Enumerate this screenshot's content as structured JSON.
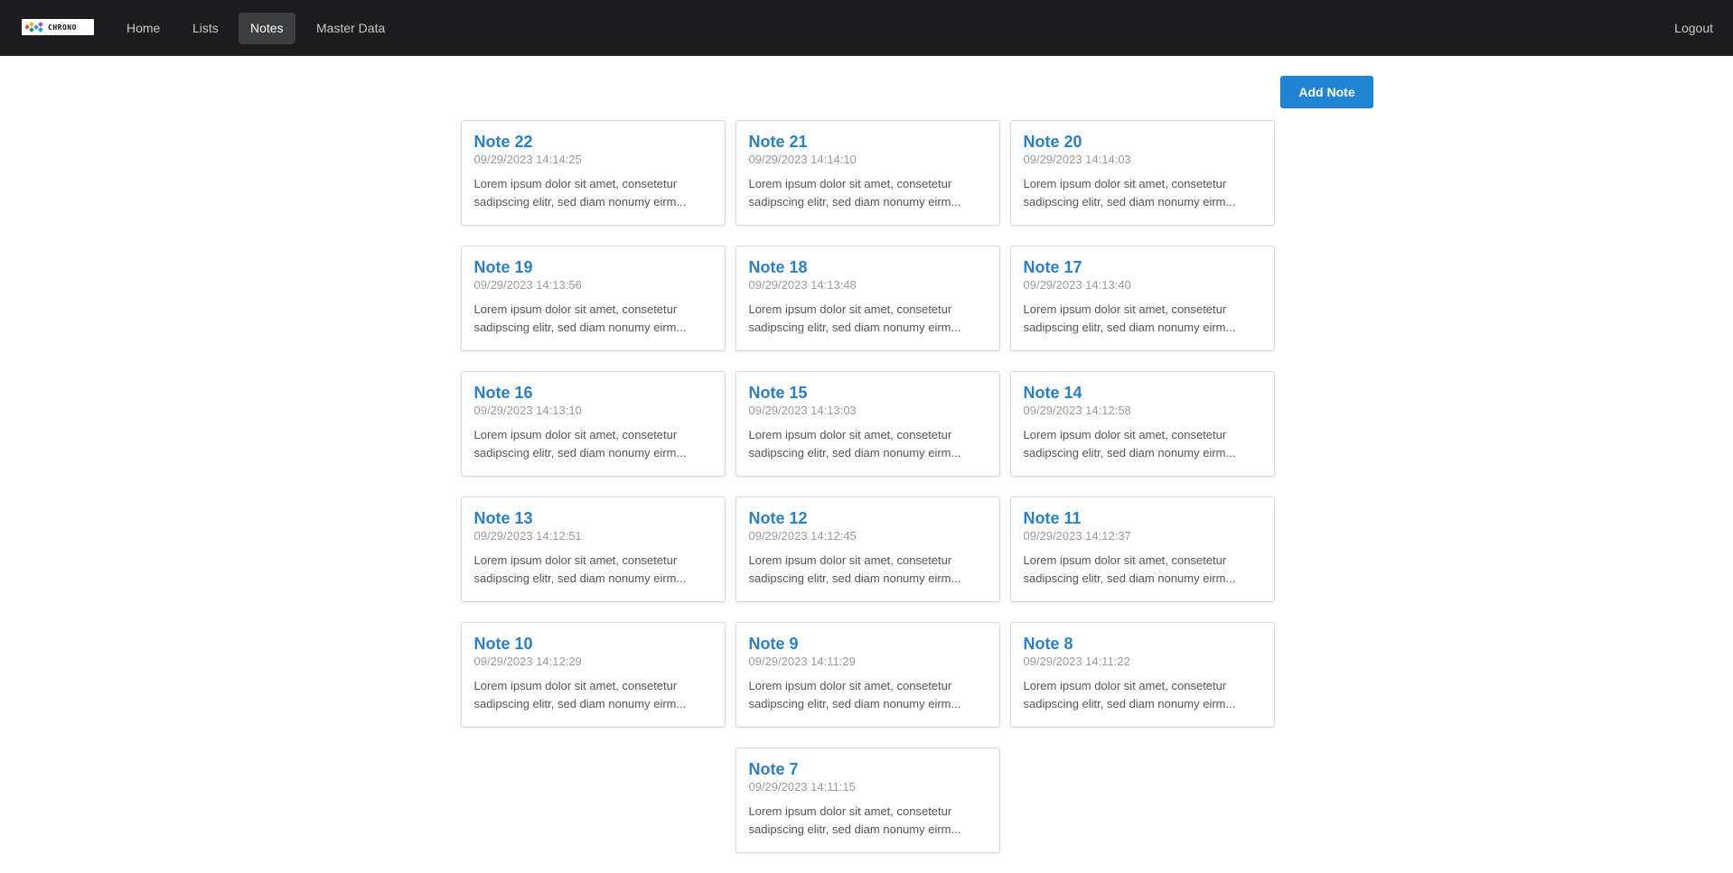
{
  "navbar": {
    "logo_text": "CHRONO",
    "items": [
      {
        "label": "Home",
        "active": false
      },
      {
        "label": "Lists",
        "active": false
      },
      {
        "label": "Notes",
        "active": true
      },
      {
        "label": "Master Data",
        "active": false
      }
    ],
    "logout_label": "Logout",
    "bg_color": "#1c1c1e"
  },
  "toolbar": {
    "add_label": "Add Note",
    "accent_color": "#2285d4"
  },
  "notes": [
    {
      "title": "Note 22",
      "date": "09/29/2023 14:14:25",
      "excerpt": "Lorem ipsum dolor sit amet, consetetur sadipscing elitr, sed diam nonumy eirm..."
    },
    {
      "title": "Note 21",
      "date": "09/29/2023 14:14:10",
      "excerpt": "Lorem ipsum dolor sit amet, consetetur sadipscing elitr, sed diam nonumy eirm..."
    },
    {
      "title": "Note 20",
      "date": "09/29/2023 14:14:03",
      "excerpt": "Lorem ipsum dolor sit amet, consetetur sadipscing elitr, sed diam nonumy eirm..."
    },
    {
      "title": "Note 19",
      "date": "09/29/2023 14:13:56",
      "excerpt": "Lorem ipsum dolor sit amet, consetetur sadipscing elitr, sed diam nonumy eirm..."
    },
    {
      "title": "Note 18",
      "date": "09/29/2023 14:13:48",
      "excerpt": "Lorem ipsum dolor sit amet, consetetur sadipscing elitr, sed diam nonumy eirm..."
    },
    {
      "title": "Note 17",
      "date": "09/29/2023 14:13:40",
      "excerpt": "Lorem ipsum dolor sit amet, consetetur sadipscing elitr, sed diam nonumy eirm..."
    },
    {
      "title": "Note 16",
      "date": "09/29/2023 14:13:10",
      "excerpt": "Lorem ipsum dolor sit amet, consetetur sadipscing elitr, sed diam nonumy eirm..."
    },
    {
      "title": "Note 15",
      "date": "09/29/2023 14:13:03",
      "excerpt": "Lorem ipsum dolor sit amet, consetetur sadipscing elitr, sed diam nonumy eirm..."
    },
    {
      "title": "Note 14",
      "date": "09/29/2023 14:12:58",
      "excerpt": "Lorem ipsum dolor sit amet, consetetur sadipscing elitr, sed diam nonumy eirm..."
    },
    {
      "title": "Note 13",
      "date": "09/29/2023 14:12:51",
      "excerpt": "Lorem ipsum dolor sit amet, consetetur sadipscing elitr, sed diam nonumy eirm..."
    },
    {
      "title": "Note 12",
      "date": "09/29/2023 14:12:45",
      "excerpt": "Lorem ipsum dolor sit amet, consetetur sadipscing elitr, sed diam nonumy eirm..."
    },
    {
      "title": "Note 11",
      "date": "09/29/2023 14:12:37",
      "excerpt": "Lorem ipsum dolor sit amet, consetetur sadipscing elitr, sed diam nonumy eirm..."
    },
    {
      "title": "Note 10",
      "date": "09/29/2023 14:12:29",
      "excerpt": "Lorem ipsum dolor sit amet, consetetur sadipscing elitr, sed diam nonumy eirm..."
    },
    {
      "title": "Note 9",
      "date": "09/29/2023 14:11:29",
      "excerpt": "Lorem ipsum dolor sit amet, consetetur sadipscing elitr, sed diam nonumy eirm..."
    },
    {
      "title": "Note 8",
      "date": "09/29/2023 14:11:22",
      "excerpt": "Lorem ipsum dolor sit amet, consetetur sadipscing elitr, sed diam nonumy eirm..."
    },
    {
      "title": "Note 7",
      "date": "09/29/2023 14:11:15",
      "excerpt": "Lorem ipsum dolor sit amet, consetetur sadipscing elitr, sed diam nonumy eirm..."
    }
  ]
}
